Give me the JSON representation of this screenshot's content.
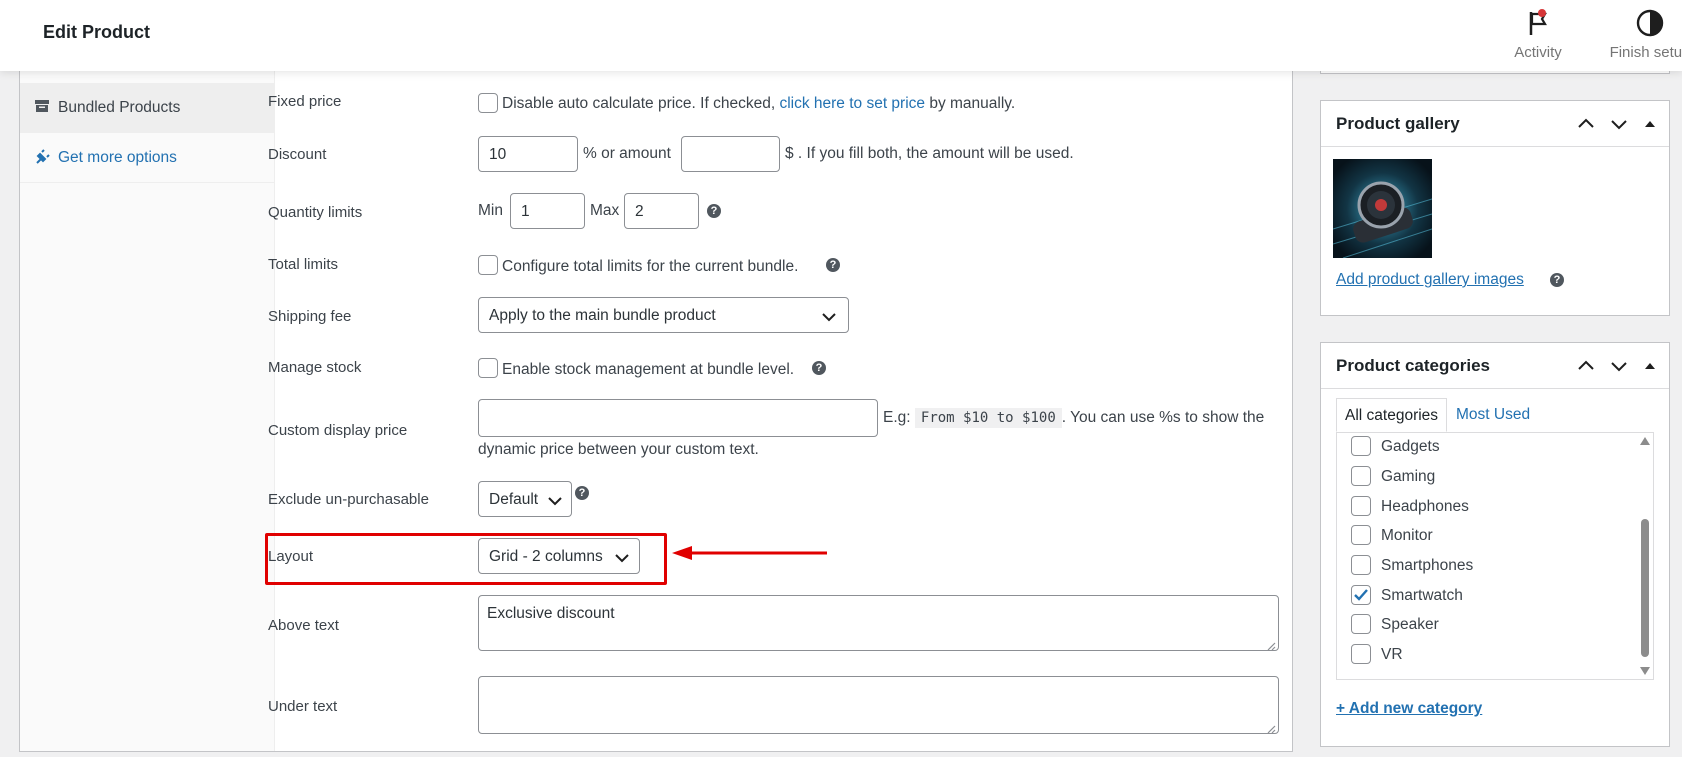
{
  "header": {
    "title": "Edit Product",
    "activity_label": "Activity",
    "finish_setup_label": "Finish setup"
  },
  "product_tabs": {
    "bundled_products": "Bundled Products",
    "get_more_options": "Get more options"
  },
  "form": {
    "fixed_price": {
      "label": "Fixed price",
      "text_before": "Disable auto calculate price. If checked,",
      "link": "click here to set price",
      "text_after": "by manually."
    },
    "discount": {
      "label": "Discount",
      "value": "10",
      "middle_text": "% or amount",
      "amount_value": "",
      "suffix": "$ . If you fill both, the amount will be used."
    },
    "quantity_limits": {
      "label": "Quantity limits",
      "min_label": "Min",
      "min_value": "1",
      "max_label": "Max",
      "max_value": "2"
    },
    "total_limits": {
      "label": "Total limits",
      "checkbox_text": "Configure total limits for the current bundle."
    },
    "shipping_fee": {
      "label": "Shipping fee",
      "selected": "Apply to the main bundle product"
    },
    "manage_stock": {
      "label": "Manage stock",
      "checkbox_text": "Enable stock management at bundle level."
    },
    "custom_display_price": {
      "label": "Custom display price",
      "value": "",
      "eg_label": "E.g:",
      "eg_code": "From $10 to $100",
      "eg_text_1": ". You can use %s to show the",
      "eg_text_2": "dynamic price between your custom text."
    },
    "exclude_unpurchasable": {
      "label": "Exclude un-purchasable",
      "selected": "Default"
    },
    "layout": {
      "label": "Layout",
      "selected": "Grid - 2 columns"
    },
    "above_text": {
      "label": "Above text",
      "value": "Exclusive discount"
    },
    "under_text": {
      "label": "Under text",
      "value": ""
    }
  },
  "product_gallery": {
    "title": "Product gallery",
    "add_link": "Add product gallery images"
  },
  "product_categories": {
    "title": "Product categories",
    "tab_all": "All categories",
    "tab_most_used": "Most Used",
    "items": [
      {
        "name": "Gadgets",
        "checked": false
      },
      {
        "name": "Gaming",
        "checked": false
      },
      {
        "name": "Headphones",
        "checked": false
      },
      {
        "name": "Monitor",
        "checked": false
      },
      {
        "name": "Smartphones",
        "checked": false
      },
      {
        "name": "Smartwatch",
        "checked": true
      },
      {
        "name": "Speaker",
        "checked": false
      },
      {
        "name": "VR",
        "checked": false
      }
    ],
    "add_new": "+ Add new category"
  },
  "colors": {
    "accent": "#2271b1",
    "highlight": "#e00000",
    "activity_dot": "#d63638"
  },
  "icons": {
    "activity": "flag-icon",
    "finish_setup": "half-circle-icon",
    "bundled_products": "box-icon",
    "get_more_options": "plugin-icon"
  }
}
